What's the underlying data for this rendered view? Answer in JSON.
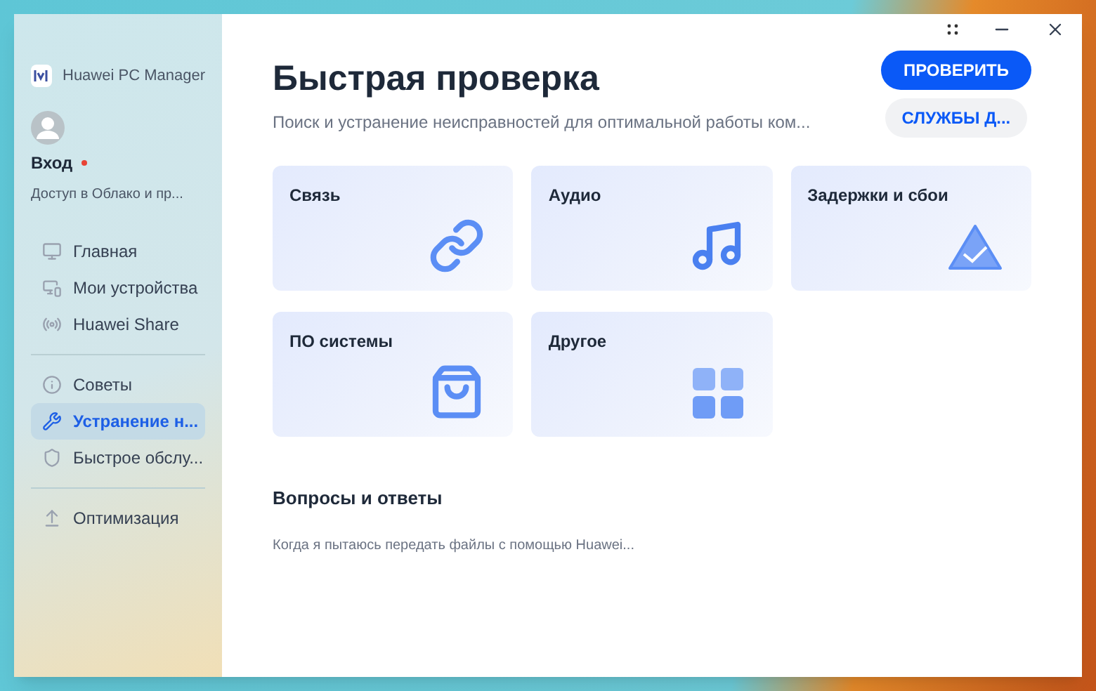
{
  "app": {
    "name": "Huawei PC Manager"
  },
  "account": {
    "login": "Вход",
    "has_notification": true,
    "subtitle": "Доступ в Облако и пр..."
  },
  "nav_groups": [
    {
      "items": [
        {
          "label": "Главная",
          "kind": "home",
          "selected": false
        },
        {
          "label": "Мои устройства",
          "kind": "devices",
          "selected": false
        },
        {
          "label": "Huawei Share",
          "kind": "share",
          "selected": false
        }
      ]
    },
    {
      "items": [
        {
          "label": "Советы",
          "kind": "tips",
          "selected": false
        },
        {
          "label": "Устранение н...",
          "kind": "repair",
          "selected": true
        },
        {
          "label": "Быстрое обслу...",
          "kind": "service",
          "selected": false
        }
      ]
    },
    {
      "items": [
        {
          "label": "Оптимизация",
          "kind": "optimize",
          "selected": false
        }
      ]
    }
  ],
  "header": {
    "title": "Быстрая проверка",
    "subtitle": "Поиск и устранение неисправностей для оптимальной работы ком...",
    "primary_button": "ПРОВЕРИТЬ",
    "secondary_button": "СЛУЖБЫ Д..."
  },
  "cards": [
    {
      "label": "Связь",
      "kind": "link"
    },
    {
      "label": "Аудио",
      "kind": "music"
    },
    {
      "label": "Задержки и сбои",
      "kind": "lag"
    },
    {
      "label": "ПО системы",
      "kind": "bag"
    },
    {
      "label": "Другое",
      "kind": "grid"
    }
  ],
  "faq": {
    "title": "Вопросы и ответы",
    "items": [
      "Когда я пытаюсь передать файлы с помощью Huawei..."
    ]
  }
}
